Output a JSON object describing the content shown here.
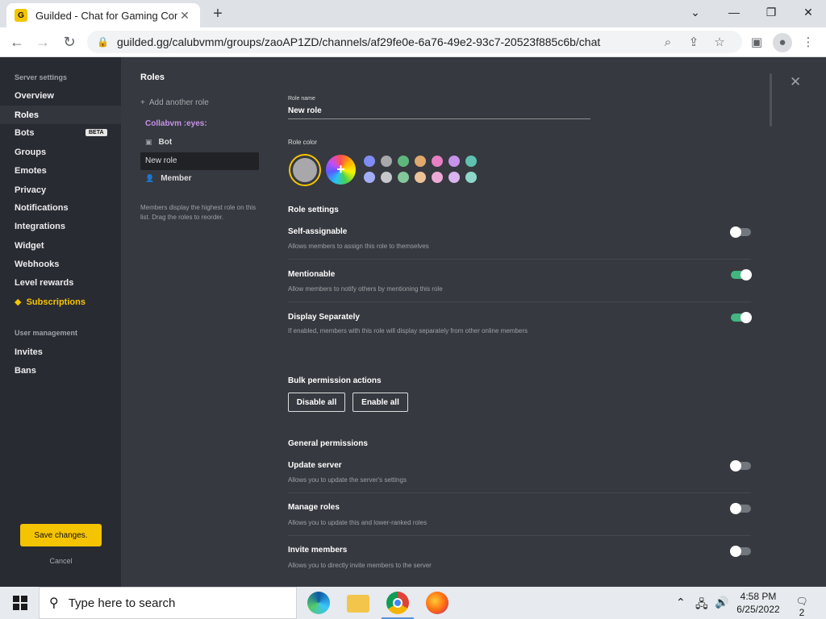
{
  "browser": {
    "tab_title": "Guilded - Chat for Gaming Comm",
    "url": "guilded.gg/calubvmm/groups/zaoAP1ZD/channels/af29fe0e-6a76-49e2-93c7-20523f885c6b/chat"
  },
  "sidebar": {
    "server_heading": "Server settings",
    "items": [
      "Overview",
      "Roles",
      "Bots",
      "Groups",
      "Emotes",
      "Privacy",
      "Notifications",
      "Integrations",
      "Widget",
      "Webhooks",
      "Level rewards",
      "Subscriptions"
    ],
    "beta_badge": "BETA",
    "user_heading": "User management",
    "user_items": [
      "Invites",
      "Bans"
    ],
    "save_label": "Save changes.",
    "cancel_label": "Cancel"
  },
  "roles_panel": {
    "title": "Roles",
    "add_label": "Add another role",
    "group_label": "Collabvm :eyes:",
    "roles": [
      "Bot",
      "New role",
      "Member"
    ],
    "help_text": "Members display the highest role on this list. Drag the roles to reorder."
  },
  "editor": {
    "role_name_label": "Role name",
    "role_name_value": "New role",
    "role_color_label": "Role color",
    "selected_color": "#a8a8ab",
    "palette_row1": [
      "#7f8cf5",
      "#a8a8ab",
      "#5fb67d",
      "#e0a96d",
      "#e67fc4",
      "#c792ea",
      "#5fc2b0"
    ],
    "palette_row2": [
      "#a3adf7",
      "#c8c8cb",
      "#83c89a",
      "#ecc399",
      "#eeaad6",
      "#d9b4f0",
      "#8fd6ca"
    ],
    "role_settings_heading": "Role settings",
    "settings": [
      {
        "title": "Self-assignable",
        "desc": "Allows members to assign this role to themselves",
        "on": false
      },
      {
        "title": "Mentionable",
        "desc": "Allow members to notify others by mentioning this role",
        "on": true
      },
      {
        "title": "Display Separately",
        "desc": "If enabled, members with this role will display separately from other online members",
        "on": true
      }
    ],
    "bulk_heading": "Bulk permission actions",
    "disable_all": "Disable all",
    "enable_all": "Enable all",
    "general_heading": "General permissions",
    "permissions": [
      {
        "title": "Update server",
        "desc": "Allows you to update the server's settings",
        "on": false
      },
      {
        "title": "Manage roles",
        "desc": "Allows you to update this and lower-ranked roles",
        "on": false
      },
      {
        "title": "Invite members",
        "desc": "Allows you to directly invite members to the server",
        "on": false
      }
    ]
  },
  "taskbar": {
    "search_placeholder": "Type here to search",
    "time": "4:58 PM",
    "date": "6/25/2022",
    "notif_count": "2"
  }
}
